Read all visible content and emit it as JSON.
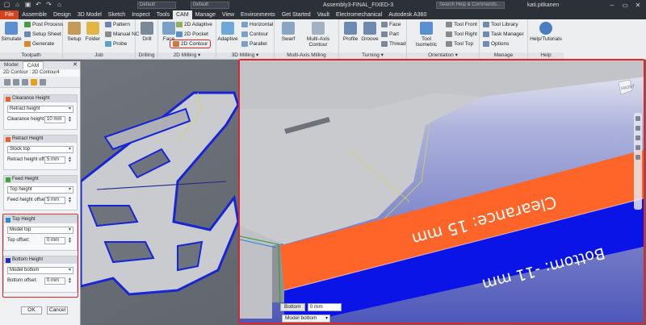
{
  "window": {
    "title": "Assembly3-FINAL_FIXED-3",
    "search_placeholder": "Search Help & Commands...",
    "user": "kati.pitkanen",
    "material_combo": "Default",
    "appearance_combo": "Default"
  },
  "ribbon_tabs": [
    "File",
    "Assemble",
    "Design",
    "3D Model",
    "Sketch",
    "Inspect",
    "Tools",
    "CAM",
    "Manage",
    "View",
    "Environments",
    "Get Started",
    "Vault",
    "Electromechanical",
    "Autodesk A360"
  ],
  "active_tab": "CAM",
  "ribbon": {
    "toolpath": {
      "label": "Toolpath",
      "simulate": "Simulate",
      "post_process": "Post Process",
      "setup_sheet": "Setup Sheet",
      "generate": "Generate"
    },
    "job": {
      "label": "Job",
      "setup": "Setup",
      "folder": "Folder",
      "pattern": "Pattern",
      "manual_nc": "Manual NC",
      "probe": "Probe"
    },
    "drilling": {
      "label": "Drilling",
      "drill": "Drill"
    },
    "milling2d": {
      "label": "2D Milling ▾",
      "face": "Face",
      "adaptive": "2D Adaptive",
      "pocket": "2D Pocket",
      "contour": "2D Contour"
    },
    "milling3d": {
      "label": "3D Milling ▾",
      "adaptive": "Adaptive",
      "horizontal": "Horizontal",
      "contour": "Contour",
      "parallel": "Parallel"
    },
    "multiaxis": {
      "label": "Multi-Axis Milling",
      "swarf": "Swarf",
      "contour": "Multi-Axis Contour"
    },
    "turning": {
      "label": "Turning ▾",
      "profile": "Profile",
      "groove": "Groove",
      "face": "Face",
      "part": "Part",
      "thread": "Thread"
    },
    "orientation": {
      "label": "Orientation ▾",
      "tool_isometric": "Tool Isometric",
      "tool_front": "Tool Front",
      "tool_right": "Tool Right",
      "tool_top": "Tool Top"
    },
    "manage": {
      "label": "Manage",
      "tool_library": "Tool Library",
      "task_manager": "Task Manager",
      "options": "Options"
    },
    "help": {
      "label": "Help",
      "help_tutorials": "Help/Tutorials"
    }
  },
  "panel": {
    "tabs": [
      "Model",
      "CAM"
    ],
    "active_tab": "CAM",
    "breadcrumb": "2D Contour : 2D Contour4",
    "sections": [
      {
        "title": "Clearance Height",
        "color": "#e8632a",
        "select": "Retract height",
        "field_label": "Clearance height ...",
        "field_value": "10 mm"
      },
      {
        "title": "Retract Height",
        "color": "#e8632a",
        "select": "Stock top",
        "field_label": "Retract height offs...",
        "field_value": "5 mm"
      },
      {
        "title": "Feed Height",
        "color": "#3aa63a",
        "select": "Top height",
        "field_label": "Feed height offset:",
        "field_value": "5 mm"
      },
      {
        "title": "Top Height",
        "color": "#2a8ad8",
        "select": "Model top",
        "field_label": "Top offset:",
        "field_value": "0 mm"
      },
      {
        "title": "Bottom Height",
        "color": "#1c2fc8",
        "select": "Model bottom",
        "field_label": "Bottom offset:",
        "field_value": "0 mm"
      }
    ],
    "ok": "OK",
    "cancel": "Cancel"
  },
  "viewport": {
    "overlay_clearance": "Clearance: 15 mm",
    "overlay_bottom": "Bottom: -11 mm",
    "viewcube_label": "FRONT",
    "bottom_label": "Bottom",
    "bottom_value": "0 mm",
    "bottom_mode": "Model bottom"
  },
  "colors": {
    "clearance": "#ff6428",
    "bottom": "#0a14e6",
    "highlight": "#e0252b",
    "file_tab": "#d4421e"
  }
}
